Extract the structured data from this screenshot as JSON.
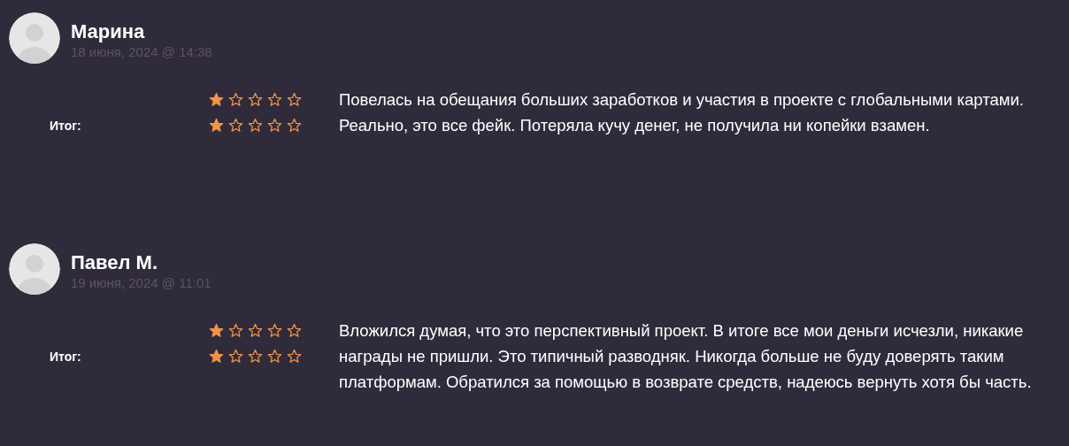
{
  "reviews": [
    {
      "name": "Марина",
      "date": "18 июня, 2024 @ 14:38",
      "ratings": [
        {
          "stars": 1
        },
        {
          "label": "Итог:",
          "stars": 1
        }
      ],
      "text": "Повелась на обещания больших заработков и участия в проекте с глобальными картами. Реально, это все фейк. Потеряла кучу денег, не получила ни копейки взамен."
    },
    {
      "name": "Павел М.",
      "date": "19 июня, 2024 @ 11:01",
      "ratings": [
        {
          "stars": 1
        },
        {
          "label": "Итог:",
          "stars": 1
        }
      ],
      "text": "Вложился думая, что это перспективный проект. В итоге все мои деньги исчезли, никакие награды не пришли. Это типичный разводняк. Никогда больше не буду доверять таким платформам. Обратился за помощью в возврате средств, надеюсь вернуть хотя бы часть."
    }
  ]
}
